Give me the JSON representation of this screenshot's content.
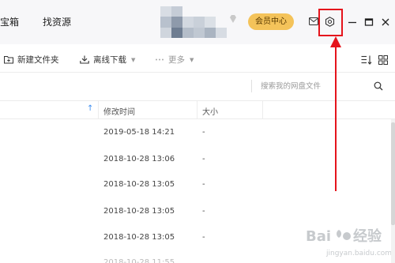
{
  "titlebar": {
    "nav": [
      "宝箱",
      "找资源"
    ],
    "vip_label": "会员中心"
  },
  "toolbar": {
    "new_folder": "新建文件夹",
    "offline_download": "离线下载",
    "more": "更多"
  },
  "search": {
    "placeholder": "搜索我的网盘文件"
  },
  "table": {
    "columns": {
      "modified": "修改时间",
      "size": "大小"
    },
    "rows": [
      {
        "modified": "2019-05-18 14:21",
        "size": "-"
      },
      {
        "modified": "2018-10-28 13:06",
        "size": "-"
      },
      {
        "modified": "2018-10-28 13:05",
        "size": "-"
      },
      {
        "modified": "2018-10-28 13:05",
        "size": "-"
      },
      {
        "modified": "2018-10-28 13:05",
        "size": "-"
      }
    ]
  },
  "colors": {
    "accent_blue": "#3b8cf0",
    "vip_gold": "#f4c35a",
    "annotation_red": "#e5141c"
  },
  "icons": [
    "diamond-icon",
    "mail-icon",
    "settings-icon",
    "minimize-icon",
    "maximize-icon",
    "close-icon",
    "new-folder-icon",
    "download-icon",
    "more-dots-icon",
    "sort-icon",
    "grid-view-icon",
    "search-icon"
  ]
}
